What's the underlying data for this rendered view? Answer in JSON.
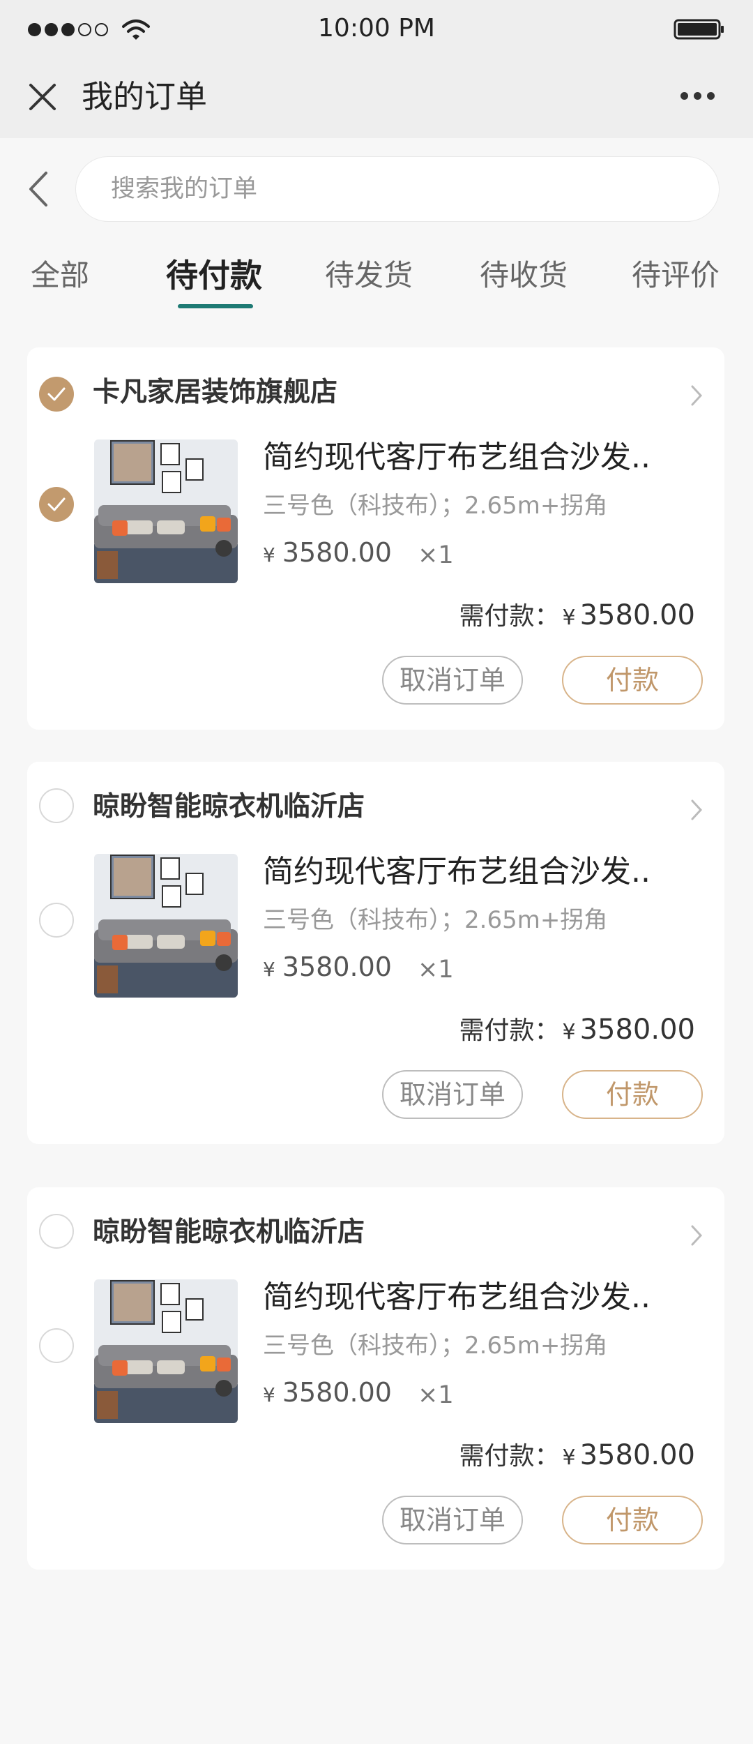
{
  "status_bar": {
    "time": "10:00 PM",
    "signal_icon": "signal-dots-icon",
    "wifi_icon": "wifi-icon",
    "battery_icon": "battery-icon"
  },
  "header": {
    "title": "我的订单",
    "close_icon": "close-icon",
    "more_icon": "more-dots-icon"
  },
  "search": {
    "placeholder": "搜索我的订单",
    "back_icon": "chevron-left-icon"
  },
  "tabs": [
    {
      "label": "全部",
      "active": false
    },
    {
      "label": "待付款",
      "active": true
    },
    {
      "label": "待发货",
      "active": false
    },
    {
      "label": "待收货",
      "active": false
    },
    {
      "label": "待评价",
      "active": false
    }
  ],
  "orders": [
    {
      "shop_name": "卡凡家居装饰旗舰店",
      "selected": true,
      "product_title": "简约现代客厅布艺组合沙发..",
      "spec": "三号色（科技布）；2.65m+拐角",
      "currency": "¥",
      "price": "3580.00",
      "qty": "×1",
      "due_label": "需付款：",
      "due_amount": "3580.00",
      "cancel_label": "取消订单",
      "pay_label": "付款"
    },
    {
      "shop_name": "晾盼智能晾衣机临沂店",
      "selected": false,
      "product_title": "简约现代客厅布艺组合沙发..",
      "spec": "三号色（科技布）；2.65m+拐角",
      "currency": "¥",
      "price": "3580.00",
      "qty": "×1",
      "due_label": "需付款：",
      "due_amount": "3580.00",
      "cancel_label": "取消订单",
      "pay_label": "付款"
    },
    {
      "shop_name": "晾盼智能晾衣机临沂店",
      "selected": false,
      "product_title": "简约现代客厅布艺组合沙发..",
      "spec": "三号色（科技布）；2.65m+拐角",
      "currency": "¥",
      "price": "3580.00",
      "qty": "×1",
      "due_label": "需付款：",
      "due_amount": "3580.00",
      "cancel_label": "取消订单",
      "pay_label": "付款"
    }
  ],
  "colors": {
    "accent_gold": "#c29a6e",
    "tab_indicator": "#1e7a74",
    "page_bg": "#f7f7f7",
    "header_bg": "#eeeeee"
  }
}
